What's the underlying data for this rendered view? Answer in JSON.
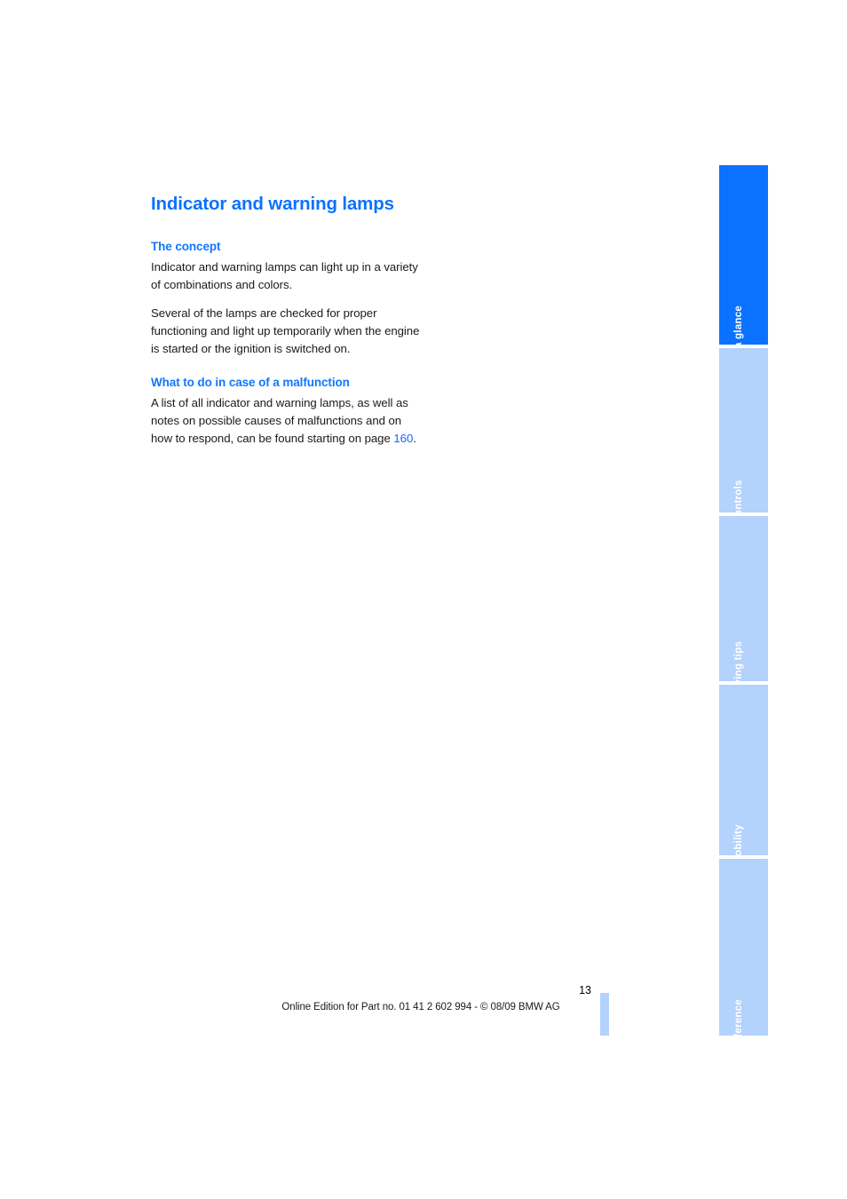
{
  "document": {
    "title": "Indicator and warning lamps",
    "page_number": "13",
    "footer_note": "Online Edition for Part no. 01 41 2 602 994 - © 08/09 BMW AG"
  },
  "sections": [
    {
      "heading": "The concept",
      "paragraphs": [
        "Indicator and warning lamps can light up in a variety of combinations and colors.",
        "Several of the lamps are checked for proper functioning and light up temporarily when the engine is started or the ignition is switched on."
      ]
    },
    {
      "heading": "What to do in case of a malfunction",
      "paragraphs": [
        "A list of all indicator and warning lamps, as well as notes on possible causes of malfunctions and on how to respond, can be found starting on page ",
        "160",
        "."
      ]
    }
  ],
  "malfunction": {
    "text_before": "A list of all indicator and warning lamps, as well as notes on possible causes of malfunctions and on how to respond, can be found starting on page ",
    "page_link": "160",
    "text_after": "."
  },
  "tabs": [
    {
      "label": "At a glance",
      "active": true
    },
    {
      "label": "Controls",
      "active": false
    },
    {
      "label": "Driving tips",
      "active": false
    },
    {
      "label": "Mobility",
      "active": false
    },
    {
      "label": "Reference",
      "active": false
    }
  ],
  "colors": {
    "accent_blue": "#0a72fe",
    "heading_blue": "#1177fe",
    "tab_inactive": "#b3d2fc",
    "link_blue": "#1466ff",
    "body_text": "#1a1a1a"
  }
}
